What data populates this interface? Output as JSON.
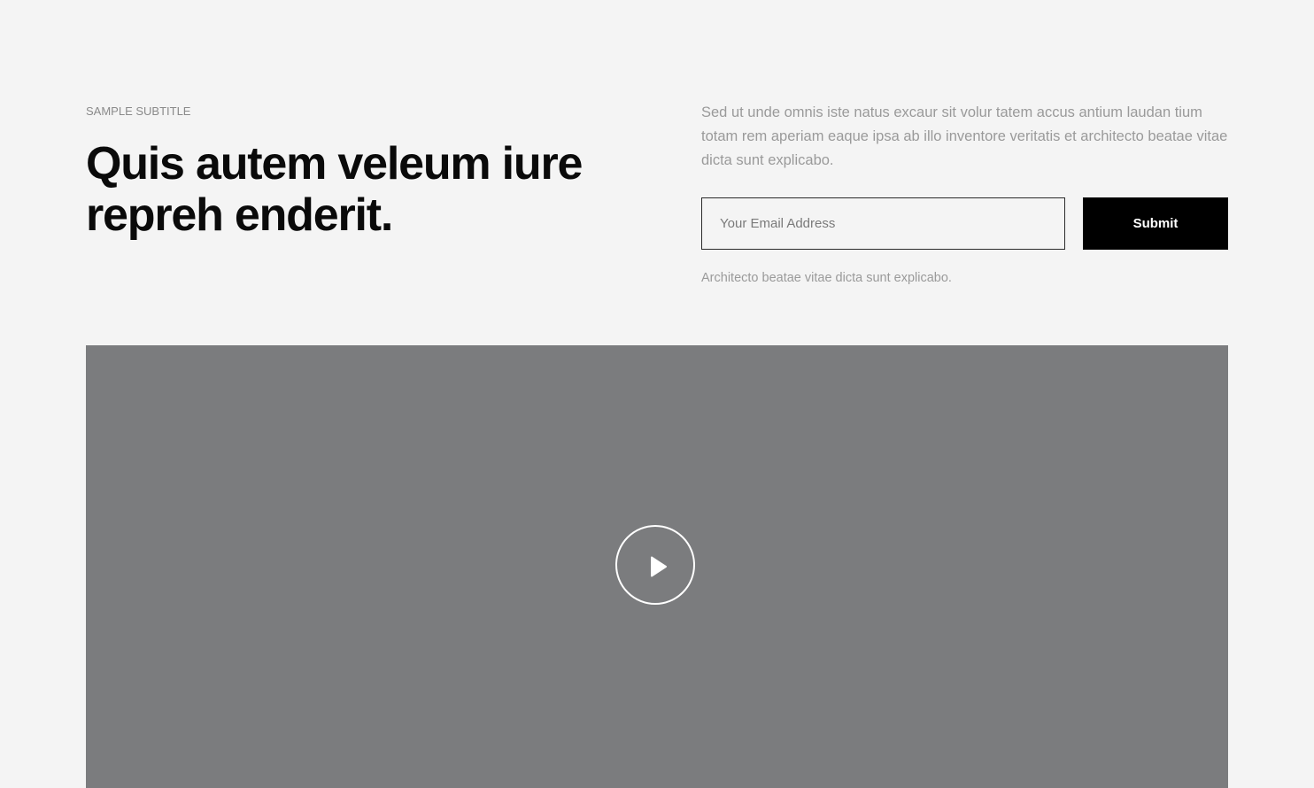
{
  "hero": {
    "subtitle": "SAMPLE SUBTITLE",
    "headline": "Quis autem veleum iure repreh enderit."
  },
  "signup": {
    "description": "Sed ut unde omnis iste natus excaur sit volur tatem accus antium laudan tium totam rem aperiam eaque ipsa ab illo inventore veritatis et architecto beatae vitae dicta sunt explicabo.",
    "email_placeholder": "Your Email Address",
    "email_value": "",
    "submit_label": "Submit",
    "note": "Architecto beatae vitae dicta sunt explicabo."
  },
  "video": {
    "play_icon": "play-icon",
    "background_color": "#7b7c7e"
  },
  "colors": {
    "page_background": "#f4f4f4",
    "button_background": "#000000",
    "headline": "#0a0a0a",
    "muted_text": "#9a9a9a"
  }
}
